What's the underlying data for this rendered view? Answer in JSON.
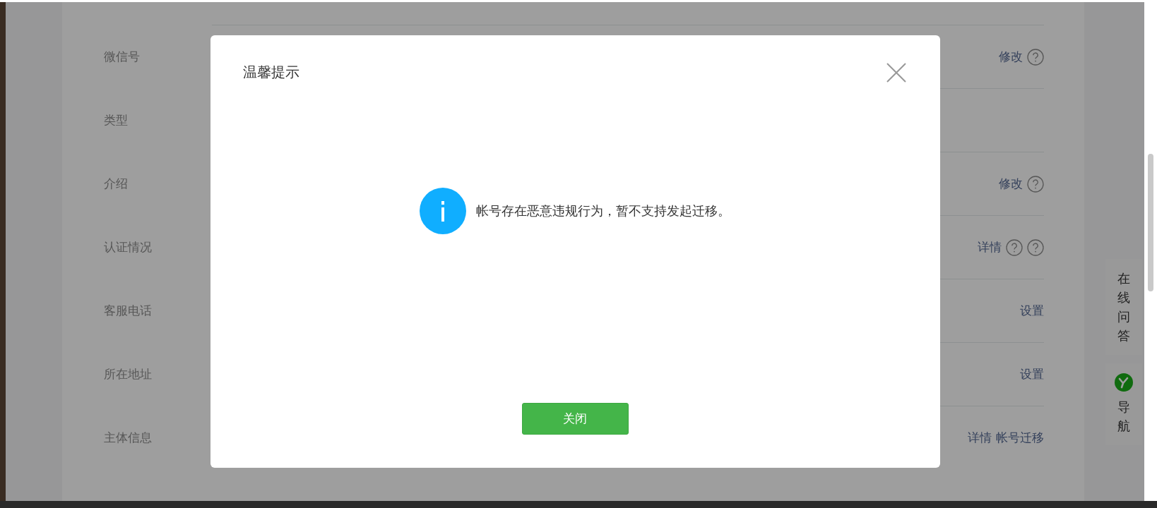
{
  "rows": [
    {
      "label": "微信号",
      "actions": [
        {
          "kind": "link",
          "text": "修改"
        },
        {
          "kind": "help"
        }
      ]
    },
    {
      "label": "类型",
      "actions": []
    },
    {
      "label": "介绍",
      "actions": [
        {
          "kind": "link",
          "text": "修改"
        },
        {
          "kind": "help"
        }
      ]
    },
    {
      "label": "认证情况",
      "actions": [
        {
          "kind": "link",
          "text": "详情"
        },
        {
          "kind": "help"
        },
        {
          "kind": "help"
        }
      ]
    },
    {
      "label": "客服电话",
      "actions": [
        {
          "kind": "link",
          "text": "设置"
        }
      ]
    },
    {
      "label": "所在地址",
      "actions": [
        {
          "kind": "link",
          "text": "设置"
        }
      ]
    },
    {
      "label": "主体信息",
      "actions": [
        {
          "kind": "link",
          "text": "详情"
        },
        {
          "kind": "link",
          "text": "帐号迁移"
        }
      ]
    }
  ],
  "side_panel": {
    "qa": "在线问答",
    "nav": "导航"
  },
  "dialog": {
    "title": "温馨提示",
    "message": "帐号存在恶意违规行为，暂不支持发起迁移。",
    "button": "关闭"
  }
}
